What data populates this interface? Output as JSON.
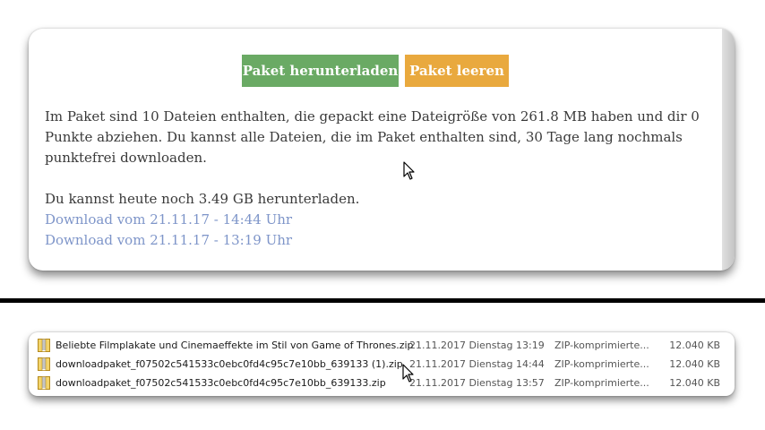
{
  "package": {
    "download_button": "Paket herunterladen",
    "clear_button": "Paket leeren",
    "info_text": "Im Paket sind 10 Dateien enthalten, die gepackt eine Dateigröße von 261.8 MB haben und dir 0 Punkte abziehen. Du kannst alle Dateien, die im Paket enthalten sind, 30 Tage lang nochmals punktefrei downloaden.",
    "quota_text": "Du kannst heute noch 3.49 GB herunterladen.",
    "downloads": [
      "Download vom 21.11.17 - 14:44 Uhr",
      "Download vom 21.11.17 - 13:19 Uhr"
    ],
    "colors": {
      "download_button": "#6aaa64",
      "clear_button": "#e9a93e",
      "link": "#7e95c9"
    }
  },
  "files": [
    {
      "name": "Beliebte Filmplakate und Cinemaeffekte im Stil von Game of Thrones.zip",
      "date": "21.11.2017 Dienstag 13:19",
      "type": "ZIP-komprimierte...",
      "size": "12.040 KB",
      "icon": "zip-folder-icon"
    },
    {
      "name": "downloadpaket_f07502c541533c0ebc0fd4c95c7e10bb_639133 (1).zip",
      "date": "21.11.2017 Dienstag 14:44",
      "type": "ZIP-komprimierte...",
      "size": "12.040 KB",
      "icon": "zip-folder-icon"
    },
    {
      "name": "downloadpaket_f07502c541533c0ebc0fd4c95c7e10bb_639133.zip",
      "date": "21.11.2017 Dienstag 13:57",
      "type": "ZIP-komprimierte...",
      "size": "12.040 KB",
      "icon": "zip-folder-icon"
    }
  ]
}
